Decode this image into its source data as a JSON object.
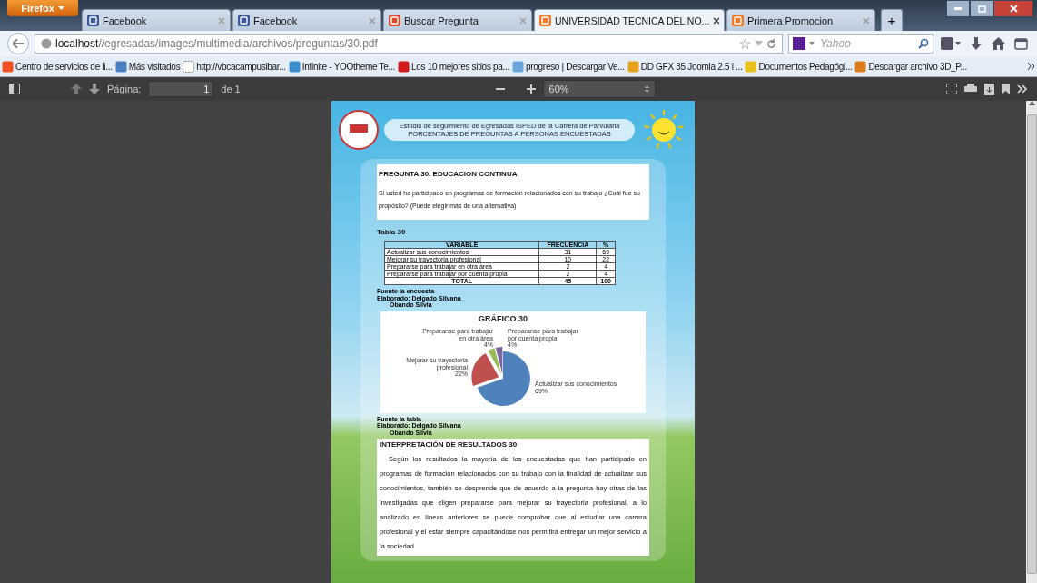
{
  "browser": {
    "menu_button": "Firefox",
    "tabs": [
      {
        "title": "Facebook",
        "kind": "facebook",
        "selected": false
      },
      {
        "title": "Facebook",
        "kind": "facebook",
        "selected": false
      },
      {
        "title": "Buscar Pregunta",
        "kind": "flame",
        "selected": false
      },
      {
        "title": "UNIVERSIDAD TECNICA DEL NO...",
        "kind": "xampp",
        "selected": true
      },
      {
        "title": "Primera Promocion",
        "kind": "xampp",
        "selected": false
      }
    ],
    "new_tab": "+",
    "address": {
      "host": "localhost",
      "path": "//egresadas/images/multimedia/archivos/preguntas/30.pdf"
    },
    "search_placeholder": "Yahoo",
    "bookmarks": [
      {
        "title": "Centro de servicios de li...",
        "kind": "tiles"
      },
      {
        "title": "Más visitados",
        "kind": "page"
      },
      {
        "title": "http://vbcacampusibar...",
        "kind": "dashed"
      },
      {
        "title": "Infinite - YOOtheme Te...",
        "kind": "cross"
      },
      {
        "title": "Los 10 mejores sitios pa...",
        "kind": "letter"
      },
      {
        "title": "progreso | Descargar Ve...",
        "kind": "cloud"
      },
      {
        "title": "DD GFX 35 Joomla 2.5 i ...",
        "kind": "gear"
      },
      {
        "title": "Documentos Pedagógi...",
        "kind": "flag"
      },
      {
        "title": "Descargar archivo 3D_P...",
        "kind": "badge"
      }
    ]
  },
  "pdf_toolbar": {
    "page_label": "Página:",
    "page_value": "1",
    "page_count": "de 1",
    "zoom": "60%"
  },
  "document": {
    "header_lines": [
      "Estudio de seguimiento de Egresadas ISPED de la Carrera de Parvularia",
      "PORCENTAJES DE PREGUNTAS A PERSONAS ENCUESTADAS"
    ],
    "question_title": "PREGUNTA 30.  EDUCACION CONTINUA",
    "question_text": "Si usted ha participado en programas de formación relacionados con su trabajo ¿Cuál fue su propósito?    (Puede elegir más de una alternativa)",
    "table_title": "Tabla 30",
    "table": {
      "columns": [
        "VARIABLE",
        "FRECUENCIA",
        "%"
      ],
      "rows": [
        [
          "Actualizar sus conocimientos",
          "31",
          "69"
        ],
        [
          "Mejorar su trayectoria profesional",
          "10",
          "22"
        ],
        [
          "Prepararse para trabajar en otra área",
          "2",
          "4"
        ],
        [
          "Prepararse para trabajar por cuenta propia",
          "2",
          "4"
        ]
      ],
      "total": [
        "TOTAL",
        "45",
        "100"
      ]
    },
    "source_1": [
      "Fuente la encuesta",
      "Elaborado: Delgado Silvana",
      "Obando Silvia"
    ],
    "chart_data": {
      "type": "pie",
      "title": "GRÁFICO 30",
      "categories": [
        "Actualizar sus conocimientos",
        "Mejorar su trayectoria profesional",
        "Preparanse para trabajar en otra área",
        "Preparanse para trabajar por cuenta propia"
      ],
      "series": [
        {
          "colors": [
            "#4f81bd",
            "#c0504d",
            "#9bbb59",
            "#8064a2"
          ],
          "values": [
            69,
            22,
            4,
            4
          ]
        }
      ],
      "value_labels": [
        "69%",
        "22%",
        "4%",
        "4%"
      ]
    },
    "source_2": [
      "Fuente la tabla",
      "Elaborado: Delgado Silvana",
      "Obando Silvia"
    ],
    "interpretation_title": "INTERPRETACIÓN DE RESULTADOS 30",
    "interpretation_text": "Según los resultados la mayoría de las encuestadas que han participado en programas de formación relacionados con su trabajo con la finalidad de actualizar sus conocimientos, también se desprende que de acuerdo a la pregunta hay otras de las investigadas que eligen prepararse para mejorar su trayectoria profesional, a lo analizado en líneas anteriores se puede comprobar que al estudiar una carrera profesional y el estar siempre capacitándose nos permitirá entregar un mejor servicio a la sociedad"
  }
}
